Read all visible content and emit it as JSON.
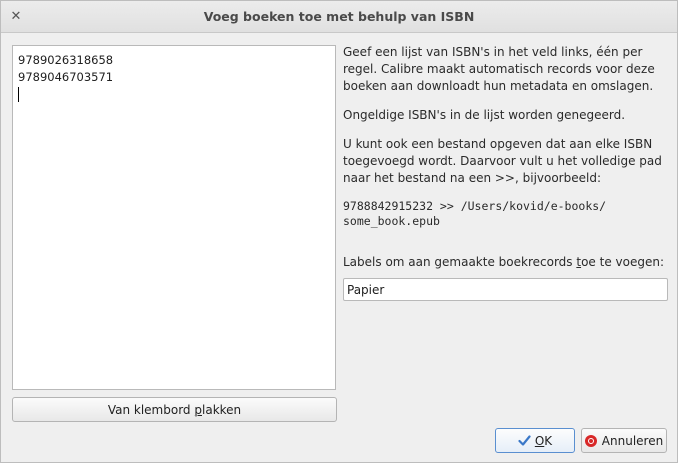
{
  "window": {
    "title": "Voeg boeken toe met behulp van ISBN",
    "close_glyph": "✕"
  },
  "isbn_list": {
    "lines": [
      "9789026318658",
      "9789046703571"
    ]
  },
  "paste_button": {
    "label_prefix": "Van klembord ",
    "label_underlined": "p",
    "label_suffix": "lakken"
  },
  "info": {
    "paragraph1": "Geef een lijst van ISBN's in het veld links, één per regel. Calibre maakt automatisch records voor deze boeken aan downloadt hun metadata en omslagen.",
    "paragraph2": "Ongeldige ISBN's in de lijst worden genegeerd.",
    "paragraph3": "U kunt ook een bestand opgeven dat aan elke ISBN toegevoegd wordt. Daarvoor vult u het volledige pad naar het bestand na een >>, bijvoorbeeld:",
    "example_line1": "9788842915232 >> /Users/kovid/e-books/",
    "example_line2": "some_book.epub"
  },
  "labels": {
    "caption_prefix": "Labels om aan gemaakte boekrecords ",
    "caption_underlined": "t",
    "caption_suffix": "oe te voegen:",
    "value": "Papier"
  },
  "buttons": {
    "ok_underlined": "O",
    "ok_suffix": "K",
    "cancel": "Annuleren"
  },
  "colors": {
    "ok_border": "#5a8fd0",
    "cancel_icon": "#d82828"
  }
}
